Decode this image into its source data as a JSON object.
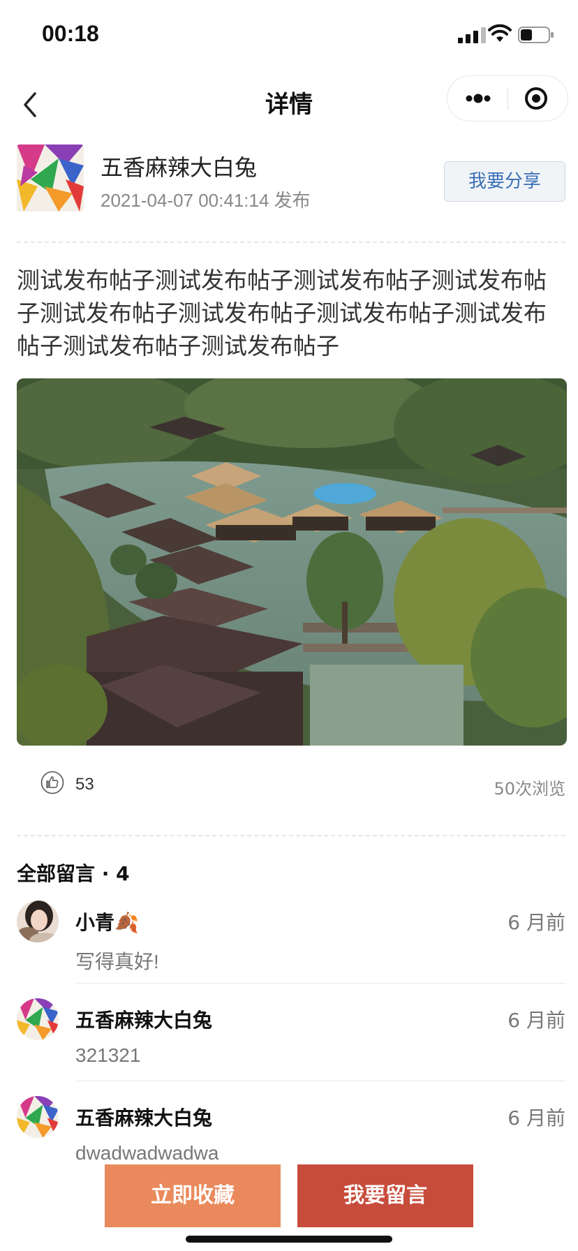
{
  "status_bar": {
    "time": "00:18"
  },
  "nav": {
    "title": "详情"
  },
  "post": {
    "author_name": "五香麻辣大白兔",
    "published": "2021-04-07 00:41:14 发布",
    "share_label": "我要分享",
    "content": "测试发布帖子测试发布帖子测试发布帖子测试发布帖子测试发布帖子测试发布帖子测试发布帖子测试发布帖子测试发布帖子测试发布帖子",
    "likes": "53",
    "views": "50次浏览"
  },
  "comments": {
    "title": "全部留言 · 4",
    "items": [
      {
        "name": "小青🍂",
        "time": "6 月前",
        "text": "写得真好!"
      },
      {
        "name": "五香麻辣大白兔",
        "time": "6 月前",
        "text": "321321"
      },
      {
        "name": "五香麻辣大白兔",
        "time": "6 月前",
        "text": "dwadwadwadwa"
      }
    ]
  },
  "actions": {
    "collect_label": "立即收藏",
    "comment_label": "我要留言"
  }
}
